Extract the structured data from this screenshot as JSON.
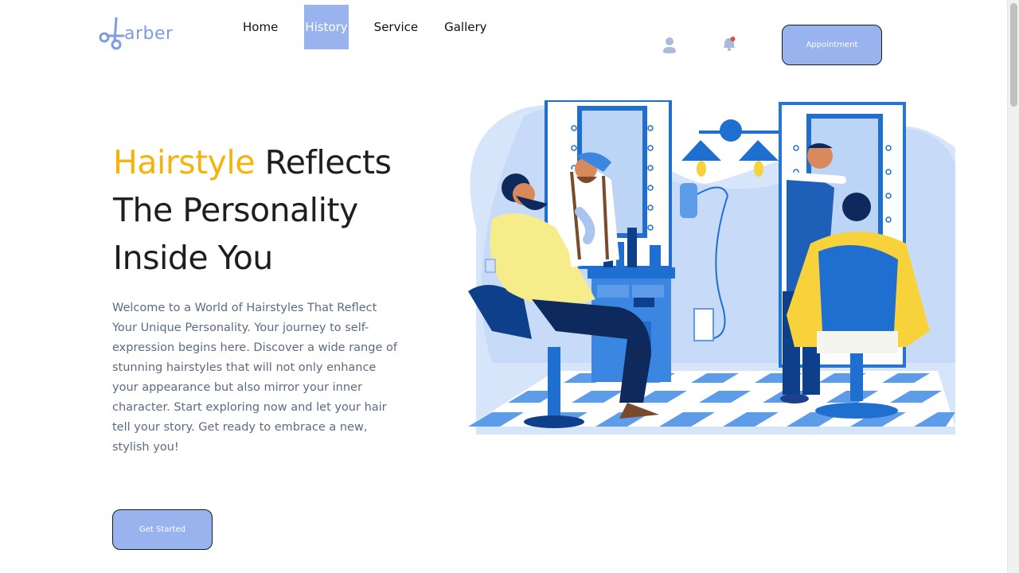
{
  "brand": {
    "logo_text": "arber",
    "accent_color": "#7d9be6"
  },
  "nav": {
    "items": [
      {
        "label": "Home",
        "active": false
      },
      {
        "label": "History",
        "active": true
      },
      {
        "label": "Service",
        "active": false
      },
      {
        "label": "Gallery",
        "active": false
      }
    ]
  },
  "header": {
    "user_icon": "user-icon",
    "bell_icon": "bell-icon",
    "appointment_label": "Appointment"
  },
  "hero": {
    "title_accent": "Hairstyle",
    "title_rest": " Reflects The Personality Inside You",
    "description": "Welcome to a World of Hairstyles That Reflect Your Unique Personality. Your journey to self-expression begins here. Discover a wide range of stunning hairstyles that will not only enhance your appearance but also mirror your inner character. Start exploring now and let your hair tell your story. Get ready to embrace a new, stylish you!",
    "cta_label": "Get Started"
  },
  "colors": {
    "button_bg": "#98b3ee",
    "title_accent": "#f5b30c",
    "title_text": "#1e1e1e",
    "body_text": "#5b6b84",
    "illustration_blue": "#1e6fd0",
    "illustration_light": "#bcd4f6",
    "illustration_yellow": "#f7ec8a"
  }
}
